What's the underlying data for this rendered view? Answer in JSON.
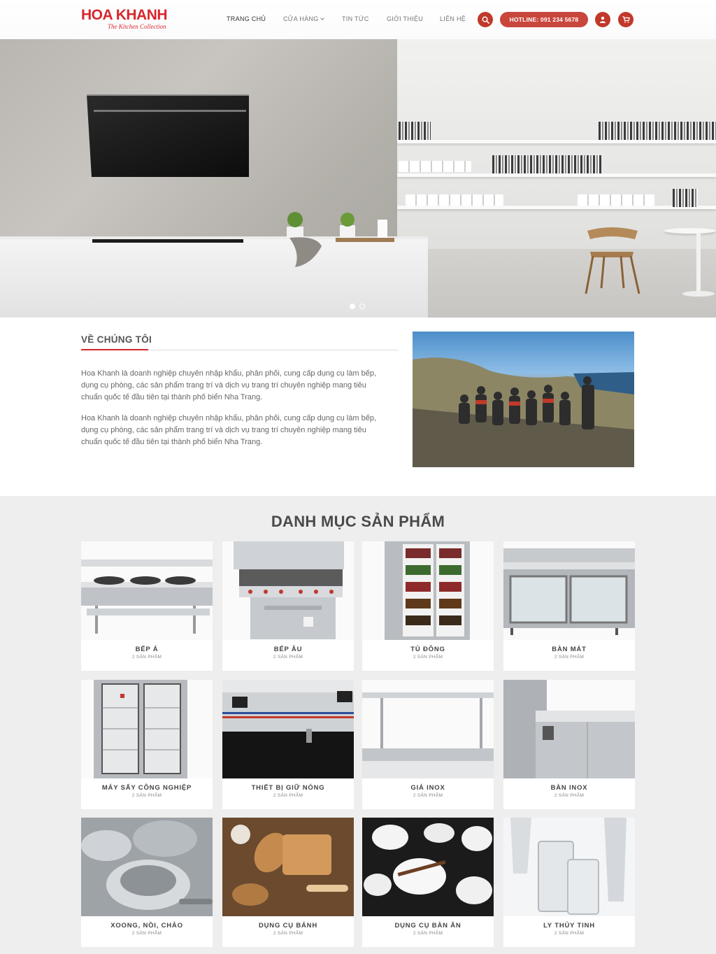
{
  "header": {
    "logo_text": "HOA KHANH",
    "logo_tagline": "The Kitchen Collection",
    "nav": [
      {
        "label": "TRANG CHỦ"
      },
      {
        "label": "CỬA HÀNG"
      },
      {
        "label": "TIN TỨC"
      },
      {
        "label": "GIỚI THIỆU"
      },
      {
        "label": "LIÊN HỆ"
      }
    ],
    "hotline": "HOTLINE: 091 234 5678",
    "icons": [
      "search-icon",
      "user-icon",
      "cart-icon"
    ],
    "accent": "#d8262e"
  },
  "hero": {
    "slide_count": 2,
    "active_slide": 1
  },
  "about": {
    "title": "VỀ CHÚNG TÔI",
    "paragraphs": [
      "Hoa Khanh là doanh nghiệp chuyên nhập khẩu, phân phối, cung cấp dụng cụ làm bếp, dụng cụ phòng, các sản phẩm trang trí và dịch vụ trang trí chuyên nghiệp mang tiêu chuẩn quốc tế đầu tiên tại thành phố biển Nha Trang.",
      "Hoa Khanh là doanh nghiệp chuyên nhập khẩu, phân phối, cung cấp dụng cụ làm bếp, dụng cụ phòng, các sản phẩm trang trí và dịch vụ trang trí chuyên nghiệp mang tiêu chuẩn quốc tế đầu tiên tại thành phố biển Nha Trang."
    ]
  },
  "categories": {
    "title": "DANH MỤC SẢN PHẨM",
    "items": [
      {
        "name": "BẾP Á",
        "count": "2 SẢN PHẨM"
      },
      {
        "name": "BẾP ÂU",
        "count": "2 SẢN PHẨM"
      },
      {
        "name": "TỦ ĐÔNG",
        "count": "2 SẢN PHẨM"
      },
      {
        "name": "BÀN MÁT",
        "count": "2 SẢN PHẨM"
      },
      {
        "name": "MÁY SẤY CÔNG NGHIỆP",
        "count": "2 SẢN PHẨM"
      },
      {
        "name": "THIẾT BỊ GIỮ NÓNG",
        "count": "2 SẢN PHẨM"
      },
      {
        "name": "GIÁ INOX",
        "count": "2 SẢN PHẨM"
      },
      {
        "name": "BÀN INOX",
        "count": "2 SẢN PHẨM"
      },
      {
        "name": "XOONG, NỒI, CHẢO",
        "count": "2 SẢN PHẨM"
      },
      {
        "name": "DỤNG CỤ BÁNH",
        "count": "2 SẢN PHẨM"
      },
      {
        "name": "DỤNG CỤ BÀN ĂN",
        "count": "2 SẢN PHẨM"
      },
      {
        "name": "LY THỦY TINH",
        "count": "2 SẢN PHẨM"
      }
    ]
  }
}
